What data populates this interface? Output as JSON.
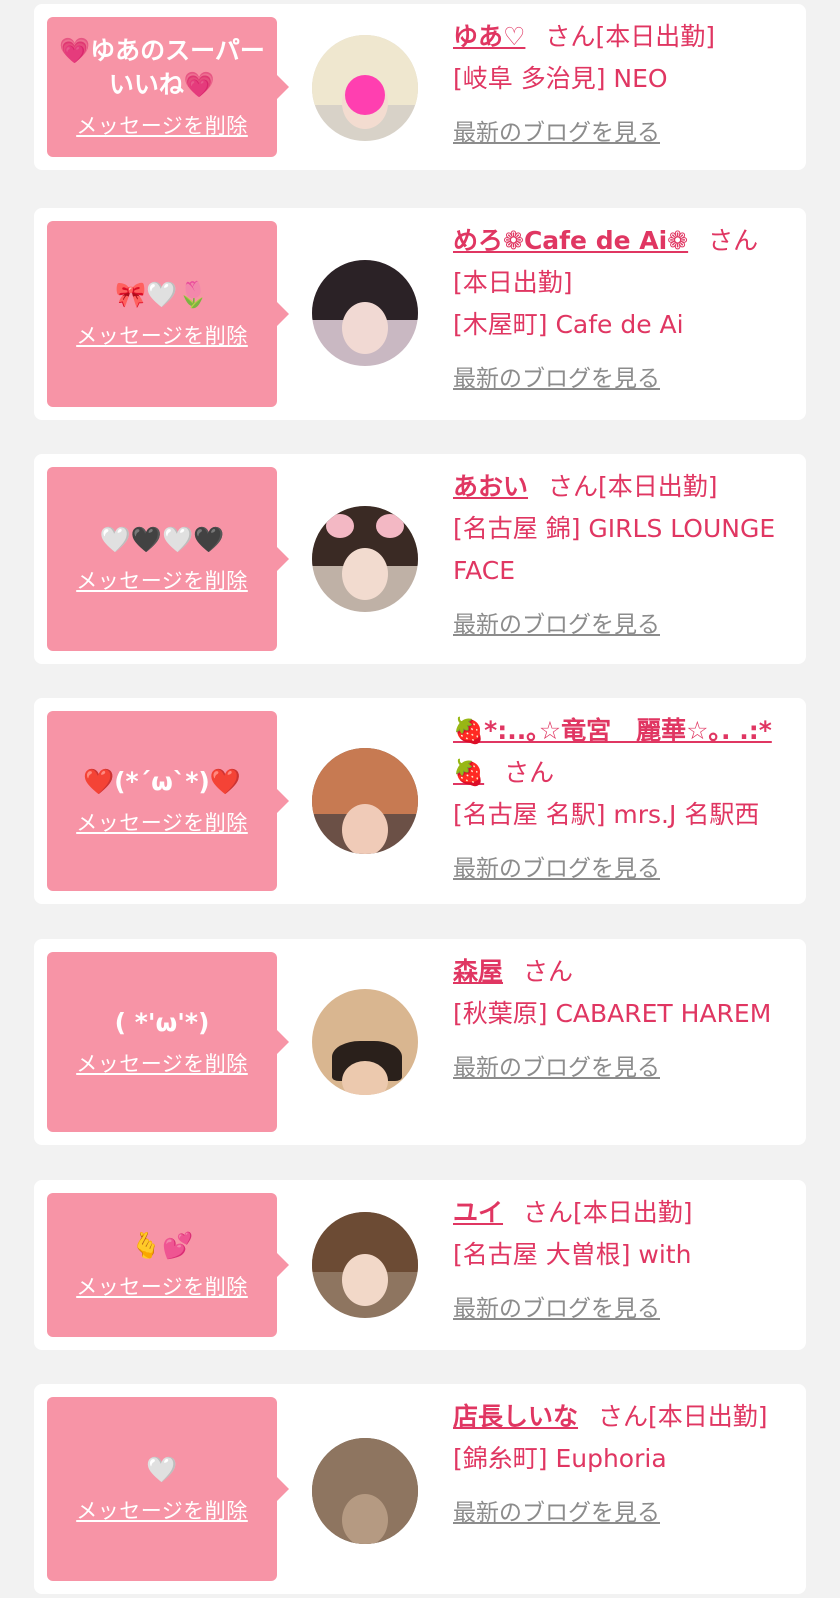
{
  "labels": {
    "delete": "メッセージを削除",
    "san": "さん",
    "blog": "最新のブログを見る"
  },
  "entries": [
    {
      "message": "💗ゆあのスーパーいいね💗",
      "name": "ゆあ♡",
      "attendance": "[本日出勤]",
      "shop": "[岐阜 多治見] NEO",
      "avatar_colors": {
        "bg": "#d8d2c8",
        "hair": "#efe7cf",
        "face": "#f3dcd0"
      }
    },
    {
      "message": "🎀🤍🌷",
      "name": "めろ❁Cafe de Ai❁",
      "attendance": "[本日出勤]",
      "shop": "[木屋町] Cafe de Ai",
      "avatar_colors": {
        "bg": "#c9b8c2",
        "hair": "#2b2226",
        "face": "#f1d9d3"
      }
    },
    {
      "message": "🤍🖤🤍🖤",
      "name": "あおい",
      "attendance": "[本日出勤]",
      "shop": "[名古屋 錦] GIRLS LOUNGE FACE",
      "avatar_colors": {
        "bg": "#bfb1a6",
        "hair": "#3a2a24",
        "face": "#f2dbcf"
      }
    },
    {
      "message": "❤️(*´ω`*)❤️",
      "name": "🍓*:..｡☆竜宮　麗華☆｡. .:*🍓",
      "attendance": "",
      "shop": "[名古屋 名駅] mrs.J 名駅西",
      "avatar_colors": {
        "bg": "#6b5046",
        "hair": "#c77a52",
        "face": "#f0cbb8"
      }
    },
    {
      "message": "( *'ω'*)",
      "name": "森屋",
      "attendance": "",
      "shop": "[秋葉原] CABARET HAREM",
      "avatar_colors": {
        "bg": "#d9b690",
        "hair": "#2a201b",
        "face": "#ecc9ae"
      }
    },
    {
      "message": "🫰💕",
      "name": "ユイ",
      "attendance": "[本日出勤]",
      "shop": "[名古屋 大曽根] with",
      "avatar_colors": {
        "bg": "#8e7560",
        "hair": "#6c4b34",
        "face": "#f2d8c8"
      }
    },
    {
      "message": "🤍",
      "name": "店長しいな",
      "attendance": "[本日出勤]",
      "shop": "[錦糸町] Euphoria",
      "avatar_colors": {
        "bg": "#6e5a48",
        "hair": "#8e7560",
        "face": "#b59a82"
      }
    }
  ]
}
